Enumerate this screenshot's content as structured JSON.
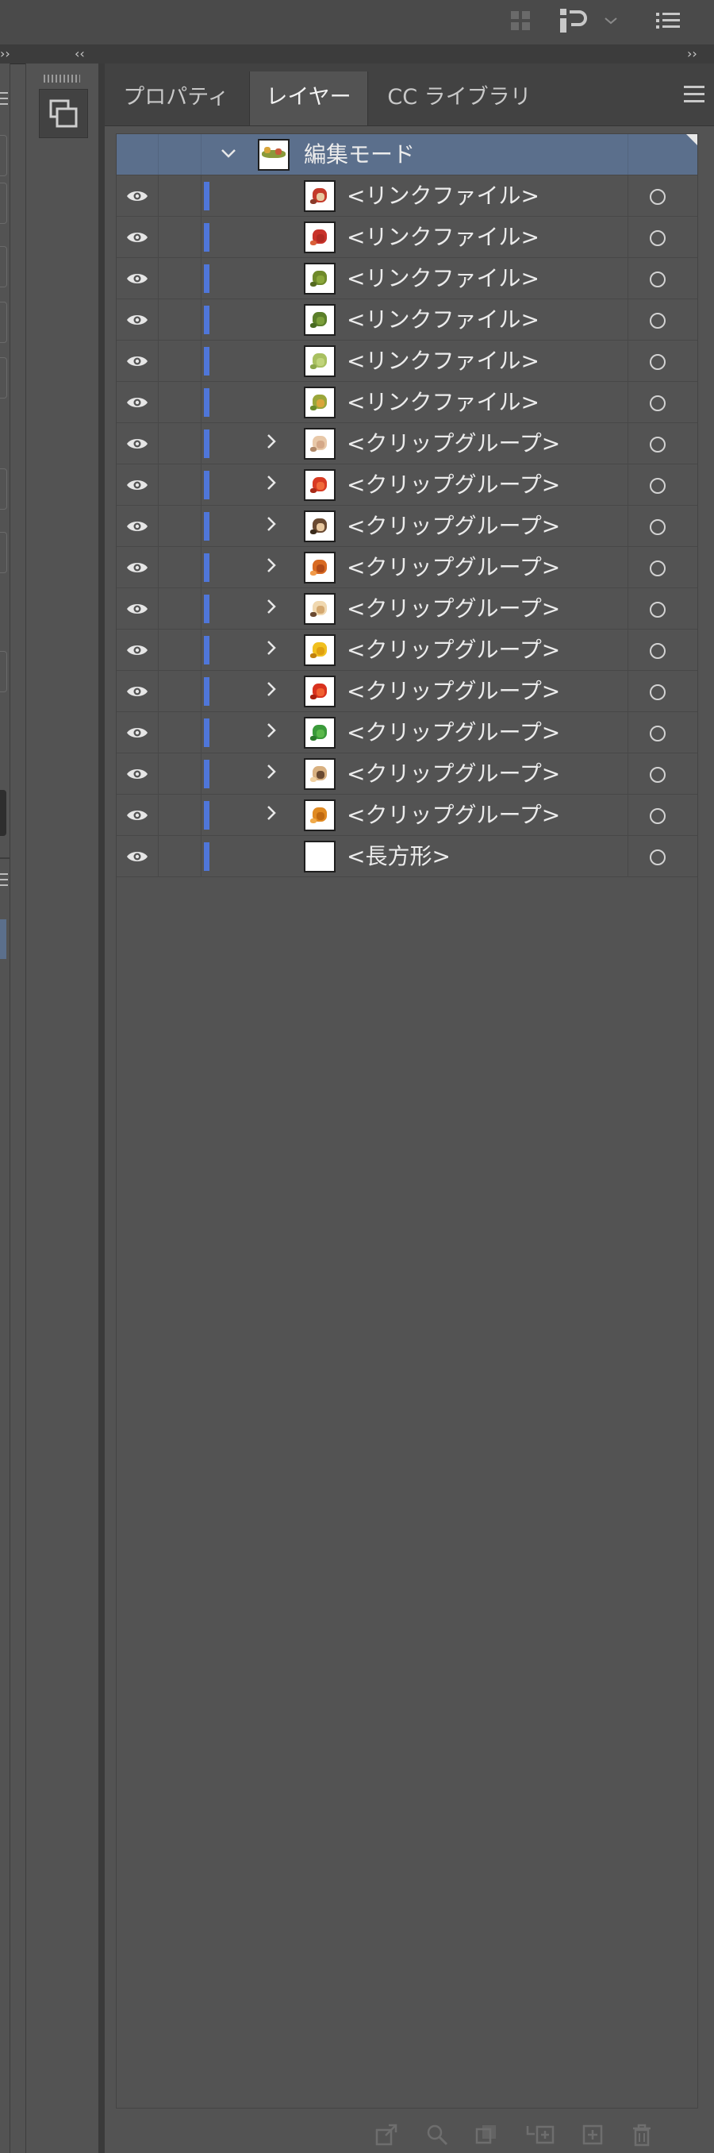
{
  "top_bar": {
    "icons": [
      "grid-icon",
      "app-switcher-icon",
      "chevron-down-icon",
      "list-icon"
    ]
  },
  "collapse_strip": {
    "left": "››",
    "center": "‹‹",
    "right": "››"
  },
  "left_panel": {
    "menu_icon": "hamburger-icon"
  },
  "dock": {
    "button_icon": "layers-stack-icon"
  },
  "tabs": [
    {
      "label": "プロパティ",
      "active": false
    },
    {
      "label": "レイヤー",
      "active": true
    },
    {
      "label": "CC ライブラリ",
      "active": false
    }
  ],
  "layers": {
    "header": {
      "label": "編集モード",
      "expanded": true
    },
    "items": [
      {
        "label": "<リンクファイル>",
        "expandable": false,
        "thumb": "red-flowers"
      },
      {
        "label": "<リンクファイル>",
        "expandable": false,
        "thumb": "red-leaves"
      },
      {
        "label": "<リンクファイル>",
        "expandable": false,
        "thumb": "green-sprig"
      },
      {
        "label": "<リンクファイル>",
        "expandable": false,
        "thumb": "green-leaf"
      },
      {
        "label": "<リンクファイル>",
        "expandable": false,
        "thumb": "light-green-sprig"
      },
      {
        "label": "<リンクファイル>",
        "expandable": false,
        "thumb": "leaf-garland"
      },
      {
        "label": "<クリップグループ>",
        "expandable": true,
        "thumb": "beige-figure"
      },
      {
        "label": "<クリップグループ>",
        "expandable": true,
        "thumb": "red-cup"
      },
      {
        "label": "<クリップグループ>",
        "expandable": true,
        "thumb": "brown-face"
      },
      {
        "label": "<クリップグループ>",
        "expandable": true,
        "thumb": "orange-block"
      },
      {
        "label": "<クリップグループ>",
        "expandable": true,
        "thumb": "cream-face"
      },
      {
        "label": "<クリップグループ>",
        "expandable": true,
        "thumb": "yellow-cup"
      },
      {
        "label": "<クリップグループ>",
        "expandable": true,
        "thumb": "red-block"
      },
      {
        "label": "<クリップグループ>",
        "expandable": true,
        "thumb": "green-block"
      },
      {
        "label": "<クリップグループ>",
        "expandable": true,
        "thumb": "tan-face"
      },
      {
        "label": "<クリップグループ>",
        "expandable": true,
        "thumb": "amber-block"
      },
      {
        "label": "<長方形>",
        "expandable": false,
        "thumb": "white-rect"
      }
    ]
  },
  "bottom_toolbar": [
    "export-icon",
    "search-icon",
    "clipping-mask-icon",
    "new-sublayer-icon",
    "new-layer-icon",
    "trash-icon"
  ],
  "colors": {
    "selection_blue": "#4f76d9",
    "header_row": "#5b6f8c",
    "panel_bg": "#535353"
  }
}
